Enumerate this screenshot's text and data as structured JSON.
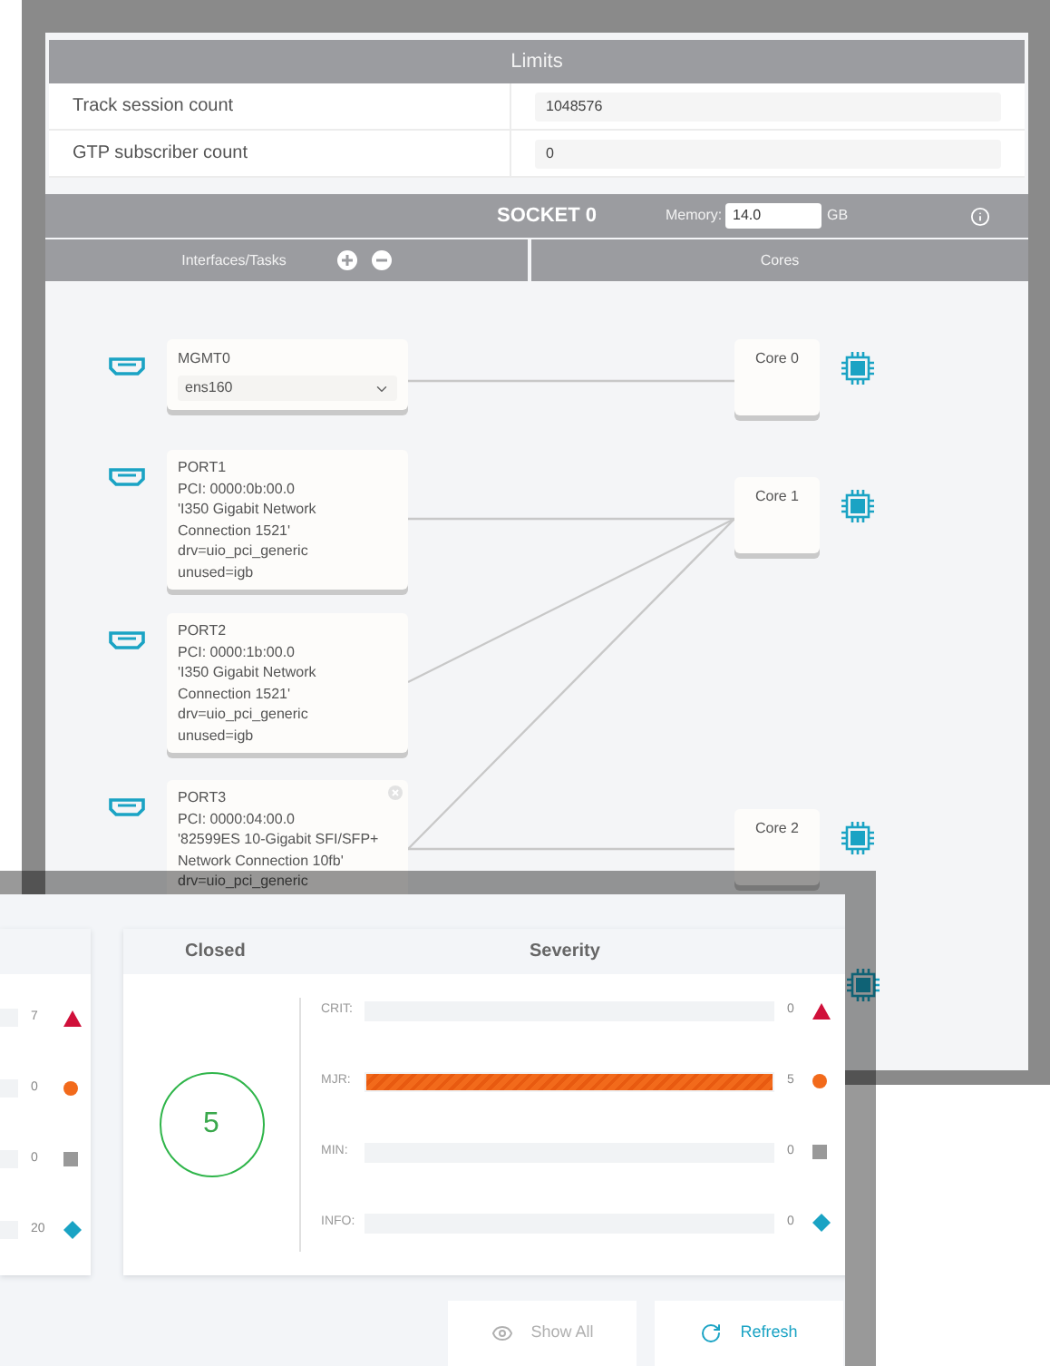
{
  "limits": {
    "title": "Limits",
    "rows": [
      {
        "label": "Track session count",
        "value": "1048576"
      },
      {
        "label": "GTP subscriber count",
        "value": "0"
      }
    ]
  },
  "socket": {
    "title": "SOCKET 0",
    "memory_label": "Memory:",
    "memory_value": "14.0",
    "memory_unit": "GB",
    "columns": [
      "Interfaces/Tasks",
      "Cores"
    ]
  },
  "interfaces": [
    {
      "kind": "select",
      "name": "MGMT0",
      "value": "ens160"
    },
    {
      "kind": "port",
      "name": "PORT1",
      "removable": false,
      "lines": [
        "PCI: 0000:0b:00.0",
        "'I350 Gigabit Network",
        "Connection 1521'",
        "drv=uio_pci_generic",
        "unused=igb"
      ]
    },
    {
      "kind": "port",
      "name": "PORT2",
      "removable": false,
      "lines": [
        "PCI: 0000:1b:00.0",
        "'I350 Gigabit Network",
        "Connection 1521'",
        "drv=uio_pci_generic",
        "unused=igb"
      ]
    },
    {
      "kind": "port",
      "name": "PORT3",
      "removable": true,
      "lines": [
        "PCI: 0000:04:00.0",
        "'82599ES 10-Gigabit SFI/SFP+",
        "Network Connection 10fb'",
        "drv=uio_pci_generic"
      ]
    }
  ],
  "cores": [
    "Core 0",
    "Core 1",
    "Core 2"
  ],
  "alerts": {
    "left_rows": [
      {
        "value": "7",
        "kind": "critical"
      },
      {
        "value": "0",
        "kind": "major"
      },
      {
        "value": "0",
        "kind": "minor"
      },
      {
        "value": "20",
        "kind": "info"
      }
    ],
    "closed": {
      "title": "Closed",
      "count": "5"
    },
    "severity": {
      "title": "Severity",
      "rows": [
        {
          "label": "CRIT:",
          "value": "0",
          "kind": "critical",
          "level": 0
        },
        {
          "label": "MJR:",
          "value": "5",
          "kind": "major",
          "level": 1
        },
        {
          "label": "MIN:",
          "value": "0",
          "kind": "minor",
          "level": 0
        },
        {
          "label": "INFO:",
          "value": "0",
          "kind": "info",
          "level": 0
        }
      ]
    },
    "buttons": [
      {
        "label": "Show All",
        "kind": "view",
        "disabled": true
      },
      {
        "label": "Refresh",
        "kind": "refresh",
        "disabled": false
      }
    ]
  }
}
